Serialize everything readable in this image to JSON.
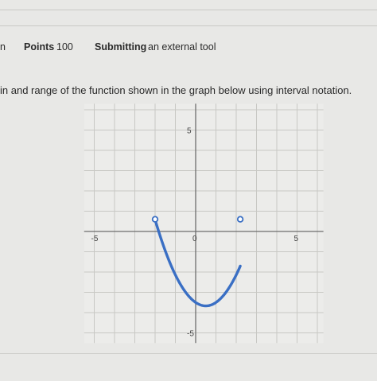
{
  "header": {
    "clipped_title": "n",
    "points_label": "Points",
    "points_value": "100",
    "submitting_label": "Submitting",
    "submitting_value": "an external tool"
  },
  "question": {
    "text": "in and range of the function shown in the graph below using interval notation."
  },
  "chart_data": {
    "type": "line",
    "title": "",
    "xlabel": "",
    "ylabel": "",
    "xlim": [
      -5.5,
      6.3
    ],
    "ylim": [
      -5.5,
      6.3
    ],
    "grid": true,
    "tick_labels": {
      "x": [
        {
          "value": -5,
          "label": "-5"
        },
        {
          "value": 0,
          "label": "0"
        },
        {
          "value": 5,
          "label": "5"
        }
      ],
      "y": [
        {
          "value": 5,
          "label": "5"
        },
        {
          "value": -5,
          "label": "-5"
        }
      ]
    },
    "series": [
      {
        "color": "#3a6fc4",
        "function": "0.68*x^2 - 0.68*x - 3.5",
        "x_range": [
          -2,
          2.2
        ],
        "endpoints": [
          {
            "x": -2,
            "y": 0.6,
            "style": "open"
          },
          {
            "x": 2.2,
            "y": 0.6,
            "style": "open"
          }
        ],
        "vertex": {
          "x": 0.5,
          "y": -3.7
        }
      }
    ]
  }
}
